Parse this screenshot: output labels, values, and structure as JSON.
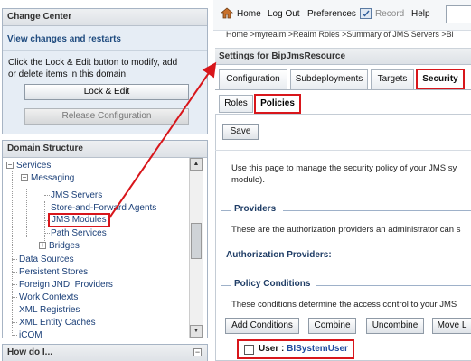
{
  "change_center": {
    "title": "Change Center",
    "subtitle": "View changes and restarts",
    "description_line1": "Click the Lock & Edit button to modify, add",
    "description_line2": "or delete items in this domain.",
    "lock_edit_label": "Lock & Edit",
    "release_label": "Release Configuration"
  },
  "domain_structure": {
    "title": "Domain Structure",
    "items": {
      "services": "Services",
      "messaging": "Messaging",
      "jms_servers": "JMS Servers",
      "saf_agents": "Store-and-Forward Agents",
      "jms_modules": "JMS Modules",
      "path_services": "Path Services",
      "bridges": "Bridges",
      "data_sources": "Data Sources",
      "persistent_stores": "Persistent Stores",
      "foreign_jndi": "Foreign JNDI Providers",
      "work_contexts": "Work Contexts",
      "xml_registries": "XML Registries",
      "xml_entity_caches": "XML Entity Caches",
      "jcom": "jCOM"
    },
    "expand_symbol": "+",
    "collapse_symbol": "−"
  },
  "how_do_i": {
    "title": "How do I...",
    "toggle_symbol": "−"
  },
  "topbar": {
    "home": "Home",
    "logout": "Log Out",
    "preferences": "Preferences",
    "record": "Record",
    "help": "Help"
  },
  "breadcrumb": "Home >myrealm >Realm Roles >Summary of JMS Servers >Bi",
  "settings": {
    "title": "Settings for BipJmsResource",
    "tabs": [
      "Configuration",
      "Subdeployments",
      "Targets",
      "Security"
    ],
    "subtabs": [
      "Roles",
      "Policies"
    ],
    "save_label": "Save",
    "intro_line1": "Use this page to manage the security policy of your JMS sy",
    "intro_line2": "module).",
    "providers_heading": "Providers",
    "providers_text": "These are the authorization providers an administrator can s",
    "auth_providers_label": "Authorization Providers:",
    "policy_conditions_heading": "Policy Conditions",
    "policy_conditions_text": "These conditions determine the access control to your JMS",
    "buttons": [
      "Add Conditions",
      "Combine",
      "Uncombine",
      "Move L"
    ],
    "user_label": "User : ",
    "user_value": "BISystemUser"
  },
  "colors": {
    "highlight_red": "#d8161b",
    "link_blue": "#1a3f78",
    "panel_border": "#a7b4c4"
  },
  "icons": {
    "home": "home-icon",
    "record": "record-icon"
  }
}
